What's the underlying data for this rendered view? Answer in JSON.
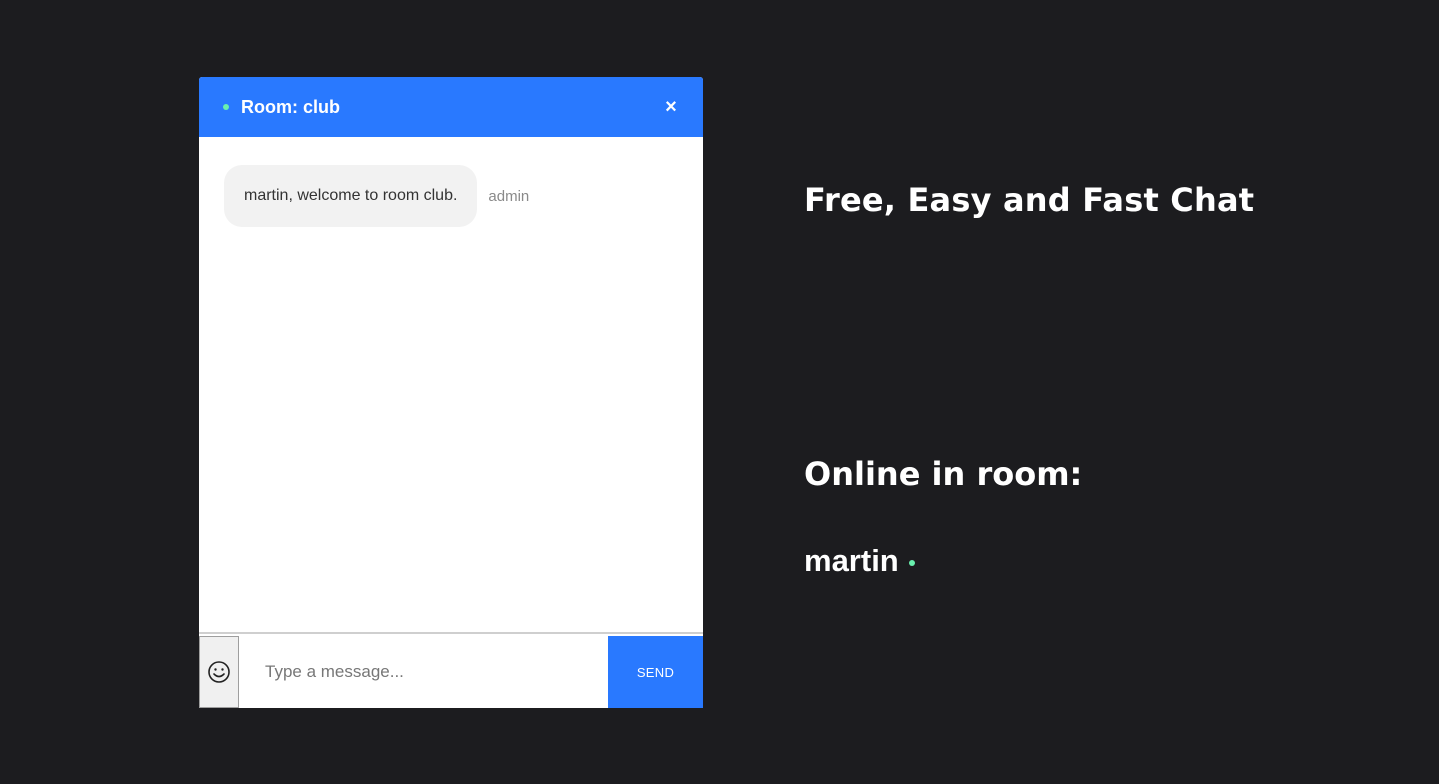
{
  "chat": {
    "room_title": "Room: club",
    "close_label": "×",
    "messages": [
      {
        "text": "martin, welcome to room club.",
        "sender": "admin"
      }
    ],
    "input_placeholder": "Type a message...",
    "send_label": "SEND",
    "emoji_icon": "smiley-icon"
  },
  "sidebar": {
    "tagline": "Free, Easy and Fast Chat",
    "online_heading": "Online in room:",
    "online_users": [
      {
        "name": "martin",
        "status": "online"
      }
    ]
  },
  "colors": {
    "background": "#1c1c1f",
    "accent": "#2979ff",
    "online": "#69f0ae",
    "bubble": "#f2f2f2"
  }
}
